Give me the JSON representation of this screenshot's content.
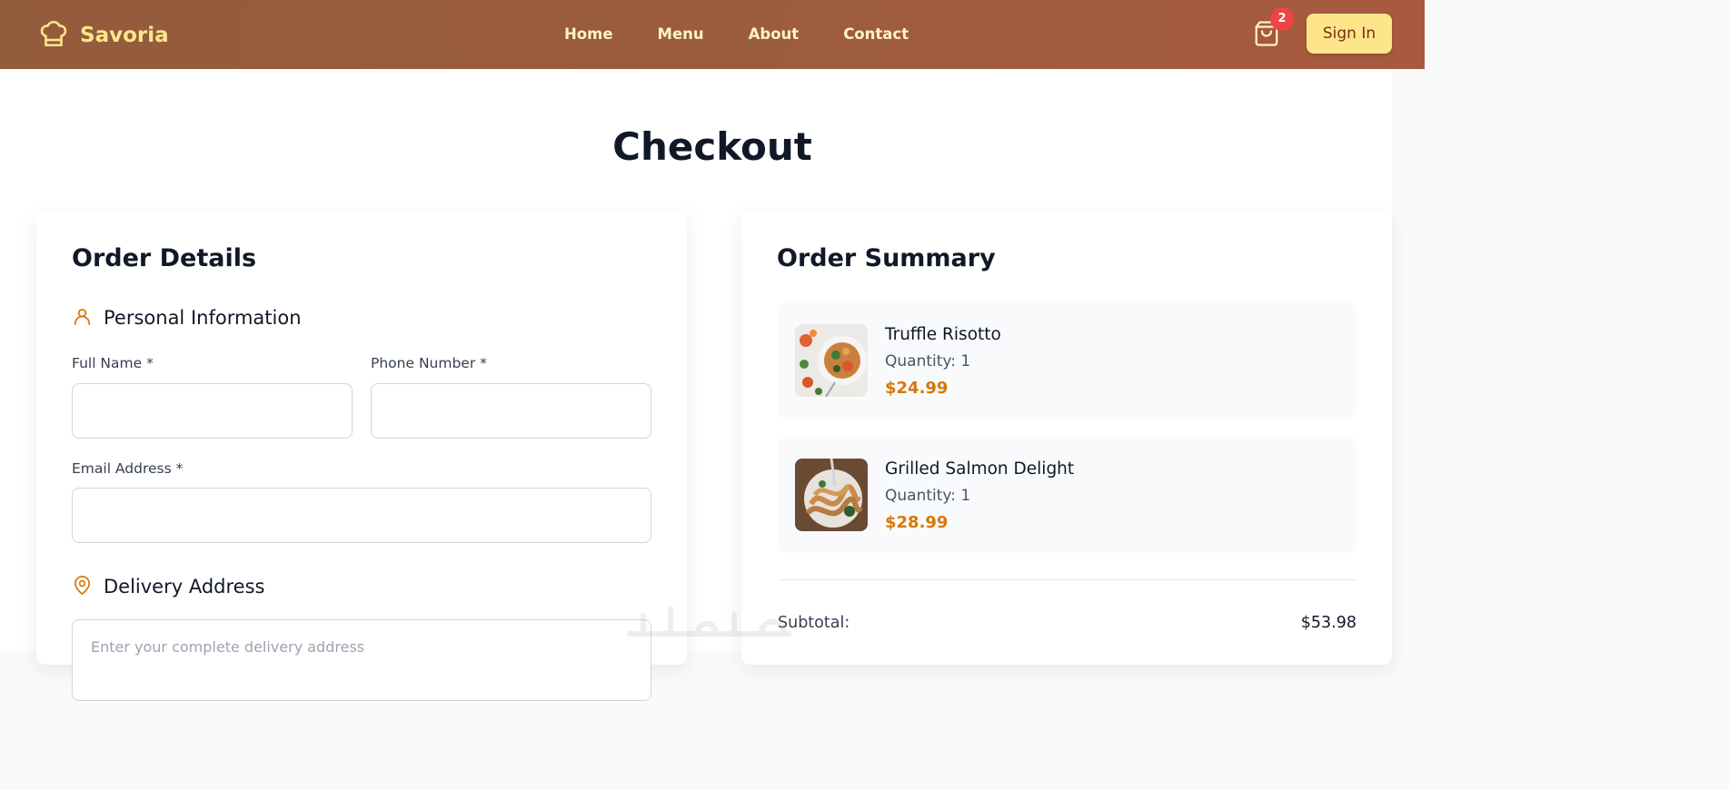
{
  "header": {
    "brand": "Savoria",
    "nav": [
      "Home",
      "Menu",
      "About",
      "Contact"
    ],
    "cart_count": "2",
    "signin_label": "Sign In",
    "brand_color": "#fde68a",
    "badge_color": "#ef4444"
  },
  "page": {
    "title": "Checkout"
  },
  "order_details": {
    "heading": "Order Details",
    "personal_section": "Personal Information",
    "full_name_label": "Full Name *",
    "full_name_value": "",
    "phone_label": "Phone Number *",
    "phone_value": "",
    "email_label": "Email Address *",
    "email_value": "",
    "delivery_section": "Delivery Address",
    "address_placeholder": "Enter your complete delivery address"
  },
  "summary": {
    "heading": "Order Summary",
    "items": [
      {
        "name": "Truffle Risotto",
        "quantity": "Quantity: 1",
        "price": "$24.99"
      },
      {
        "name": "Grilled Salmon Delight",
        "quantity": "Quantity: 1",
        "price": "$28.99"
      }
    ],
    "subtotal_label": "Subtotal:",
    "subtotal_value": "$53.98",
    "price_color": "#d97706"
  },
  "icons": {
    "brand": "chef-hat-icon",
    "cart": "shopping-bag-icon",
    "personal": "user-icon",
    "delivery": "map-pin-icon"
  }
}
